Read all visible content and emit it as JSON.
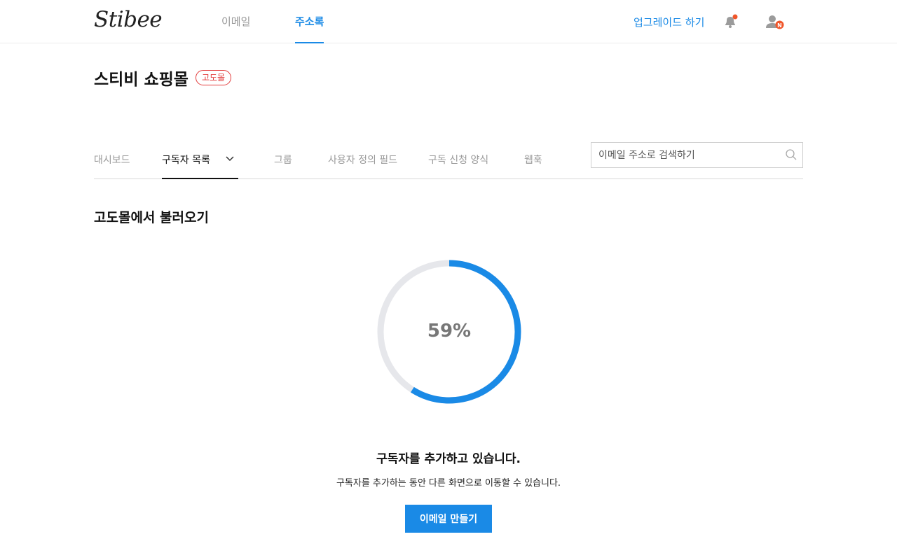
{
  "header": {
    "logo": "Stibee",
    "nav": {
      "email": "이메일",
      "address_book": "주소록"
    },
    "upgrade": "업그레이드 하기",
    "user_badge": "N"
  },
  "page": {
    "title": "스티비 쇼핑몰",
    "badge": "고도몰"
  },
  "tabs": [
    "대시보드",
    "구독자 목록",
    "그룹",
    "사용자 정의 필드",
    "구독 신청 양식",
    "웹훅"
  ],
  "search": {
    "placeholder": "이메일 주소로 검색하기"
  },
  "import": {
    "section_title": "고도몰에서 불러오기",
    "progress_percent": 59,
    "progress_label": "59%",
    "message": "구독자를 추가하고 있습니다.",
    "sub_message": "구독자를 추가하는 동안 다른 화면으로 이동할 수 있습니다.",
    "button": "이메일 만들기"
  },
  "colors": {
    "accent": "#1a8ae6",
    "badge": "#e23b3b",
    "notification": "#f0562a",
    "track": "#e6e7eb"
  },
  "icons": [
    "bell-icon",
    "user-icon",
    "chevron-down-icon",
    "search-icon"
  ]
}
